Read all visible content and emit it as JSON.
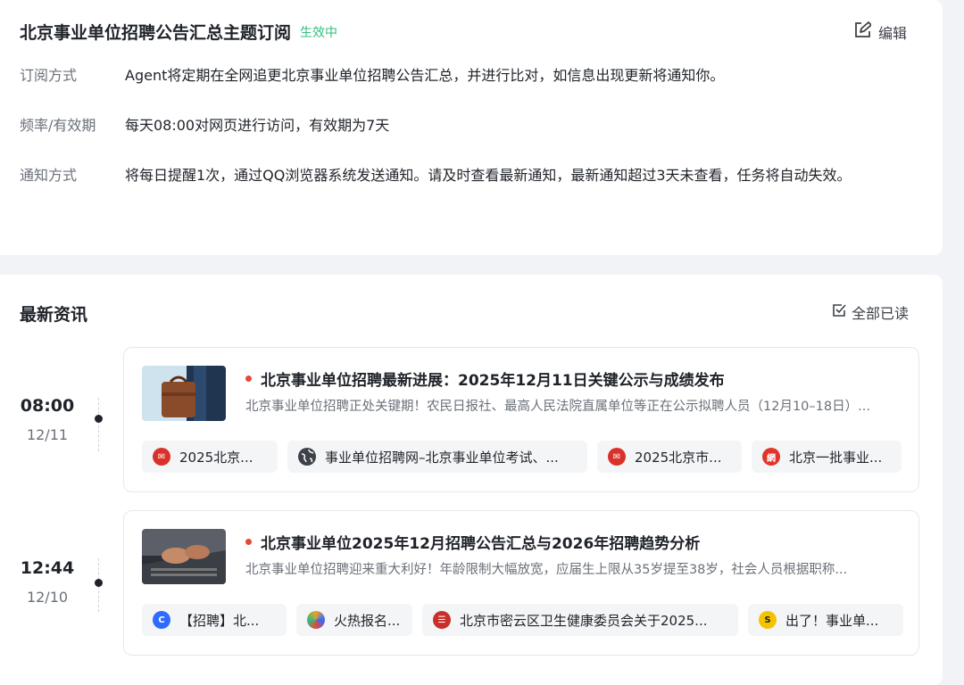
{
  "subscription": {
    "title": "北京事业单位招聘公告汇总主题订阅",
    "status": "生效中",
    "edit_label": "编辑",
    "rows": [
      {
        "label": "订阅方式",
        "value": "Agent将定期在全网追更北京事业单位招聘公告汇总，并进行比对，如信息出现更新将通知你。"
      },
      {
        "label": "频率/有效期",
        "value": "每天08:00对网页进行访问，有效期为7天"
      },
      {
        "label": "通知方式",
        "value": "将每日提醒1次，通过QQ浏览器系统发送通知。请及时查看最新通知，最新通知超过3天未查看，任务将自动失效。"
      }
    ]
  },
  "news": {
    "title": "最新资讯",
    "read_all_label": "全部已读",
    "items": [
      {
        "time": "08:00",
        "date": "12/11",
        "title": "北京事业单位招聘最新进展：2025年12月11日关键公示与成绩发布",
        "summary": "北京事业单位招聘正处关键期！农民日报社、最高人民法院直属单位等正在公示拟聘人员（12月10–18日）...",
        "sources": [
          {
            "icon": "red-logo-icon",
            "color": "#d9322b",
            "text": "2025北京..."
          },
          {
            "icon": "globe-icon",
            "color": "#3d4148",
            "text": "事业单位招聘网–北京事业单位考试、..."
          },
          {
            "icon": "red-logo-icon",
            "color": "#d9322b",
            "text": "2025北京市..."
          },
          {
            "icon": "news-logo-icon",
            "color": "#e0352b",
            "text": "北京一批事业..."
          }
        ]
      },
      {
        "time": "12:44",
        "date": "12/10",
        "title": "北京事业单位2025年12月招聘公告汇总与2026年招聘趋势分析",
        "summary": "北京事业单位招聘迎来重大利好！年龄限制大幅放宽，应届生上限从35岁提至38岁，社会人员根据职称...",
        "sources": [
          {
            "icon": "c-logo-icon",
            "color": "#2f6bff",
            "text": "【招聘】北..."
          },
          {
            "icon": "colorful-logo-icon",
            "color": "#f0a020",
            "text": "火热报名..."
          },
          {
            "icon": "seal-logo-icon",
            "color": "#c8302b",
            "text": "北京市密云区卫生健康委员会关于2025..."
          },
          {
            "icon": "s-logo-icon",
            "color": "#f5c200",
            "text": "出了！事业单..."
          }
        ]
      }
    ]
  }
}
